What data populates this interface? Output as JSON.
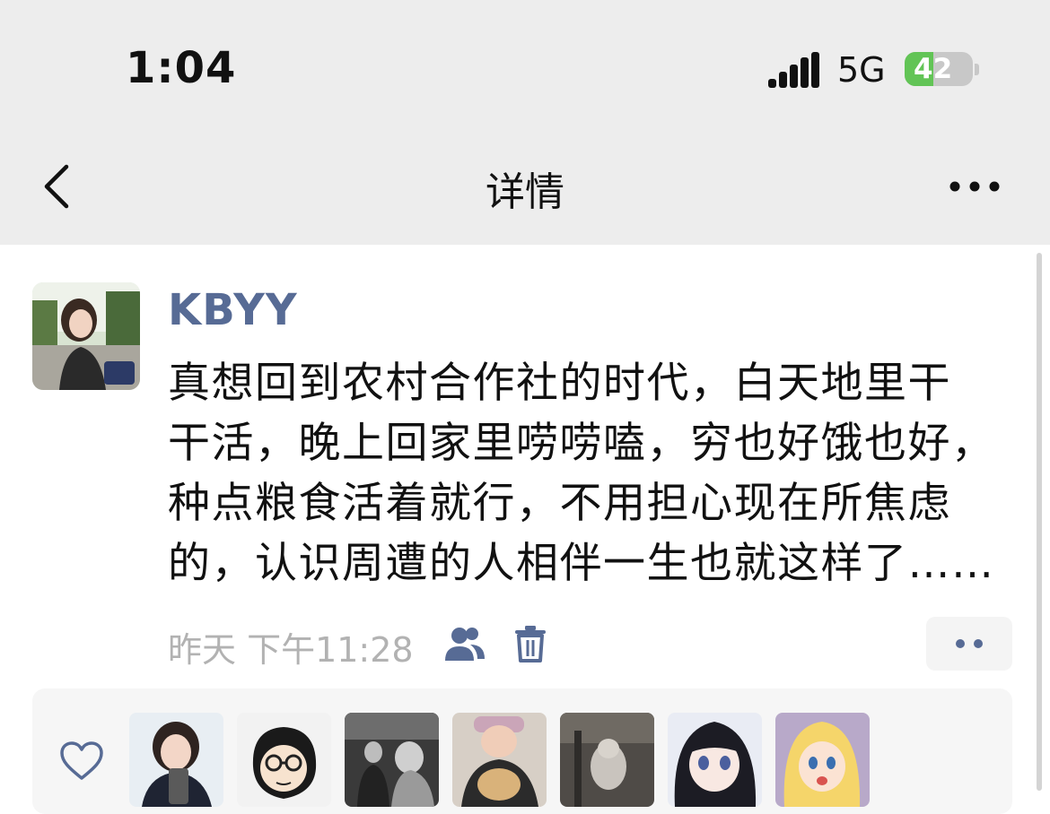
{
  "status_bar": {
    "time": "1:04",
    "network": "5G",
    "battery_level": "42",
    "battery_percent": 42
  },
  "nav": {
    "back_icon": "chevron-left-icon",
    "title": "详情",
    "more_icon": "ellipsis-icon"
  },
  "post": {
    "username": "KBYY",
    "lines": [
      "真想回到农村合作社的时代，白天地里干",
      "干活，晚上回家里唠唠嗑，穷也好饿也好，",
      "种点粮食活着就行，不用担心现在所焦虑",
      "的，认识周遭的人相伴一生也就这样了……"
    ],
    "timestamp": "昨天 下午11:28",
    "visibility_icon": "friends-icon",
    "delete_icon": "trash-icon",
    "action_icon": "two-dots-icon"
  },
  "likes": {
    "icon": "heart-icon",
    "liker_avatars": [
      "liker-avatar-1",
      "liker-avatar-2",
      "liker-avatar-3",
      "liker-avatar-4",
      "liker-avatar-5",
      "liker-avatar-6",
      "liker-avatar-7"
    ]
  },
  "colors": {
    "nav_bg": "#ededed",
    "username": "#576b95",
    "timestamp": "#b2b2b2",
    "battery_fill": "#62c456"
  }
}
